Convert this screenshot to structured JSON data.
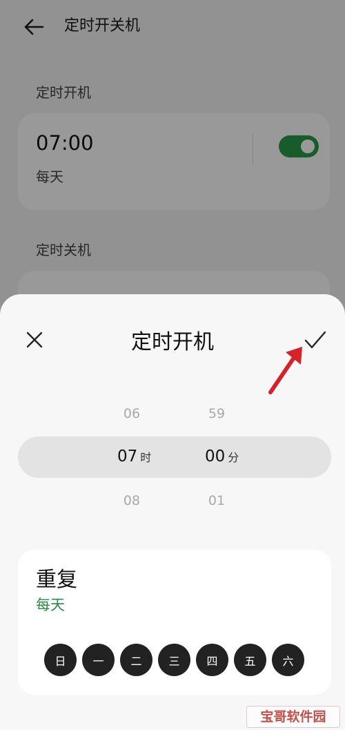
{
  "background_page": {
    "title": "定时开关机",
    "power_on_section_label": "定时开机",
    "power_on_card": {
      "time": "07:00",
      "repeat": "每天",
      "enabled": true
    },
    "power_off_section_label": "定时关机"
  },
  "sheet": {
    "title": "定时开机",
    "picker": {
      "hours": {
        "above": "06",
        "selected": "07",
        "below": "08",
        "unit": "时"
      },
      "minutes": {
        "above": "59",
        "selected": "00",
        "below": "01",
        "unit": "分"
      }
    },
    "repeat": {
      "title": "重复",
      "value": "每天",
      "days": [
        "日",
        "一",
        "二",
        "三",
        "四",
        "五",
        "六"
      ]
    }
  },
  "watermark": "宝哥软件园",
  "colors": {
    "accent_green": "#2a9a4a",
    "annotation_arrow": "#d4242a"
  },
  "icons": [
    "back-arrow-icon",
    "close-icon",
    "check-icon"
  ]
}
